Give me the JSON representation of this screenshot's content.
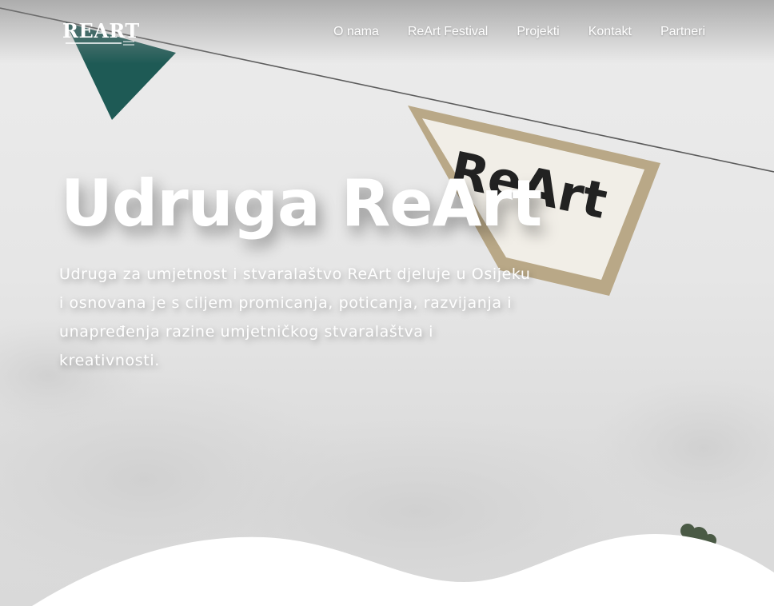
{
  "header": {
    "logo_text": "REART",
    "nav": [
      {
        "label": "O nama"
      },
      {
        "label": "ReArt Festival"
      },
      {
        "label": "Projekti"
      },
      {
        "label": "Kontakt"
      },
      {
        "label": "Partneri"
      }
    ]
  },
  "hero": {
    "title": "Udruga ReArt",
    "description": "Udruga za umjetnost i stvaralaštvo ReArt djeluje u Osijeku i osnovana je s ciljem promicanja, poticanja, razvijanja i unapređenja razine umjetničkog stvaralaštva i kreativnosti.",
    "banner_text": "ReArt"
  },
  "colors": {
    "flag_green": "#1e5a55",
    "banner_fabric": "#f1eee7",
    "banner_border": "#b9a887",
    "text": "#ffffff"
  },
  "icons": {
    "logo": "reart-logo-icon"
  }
}
